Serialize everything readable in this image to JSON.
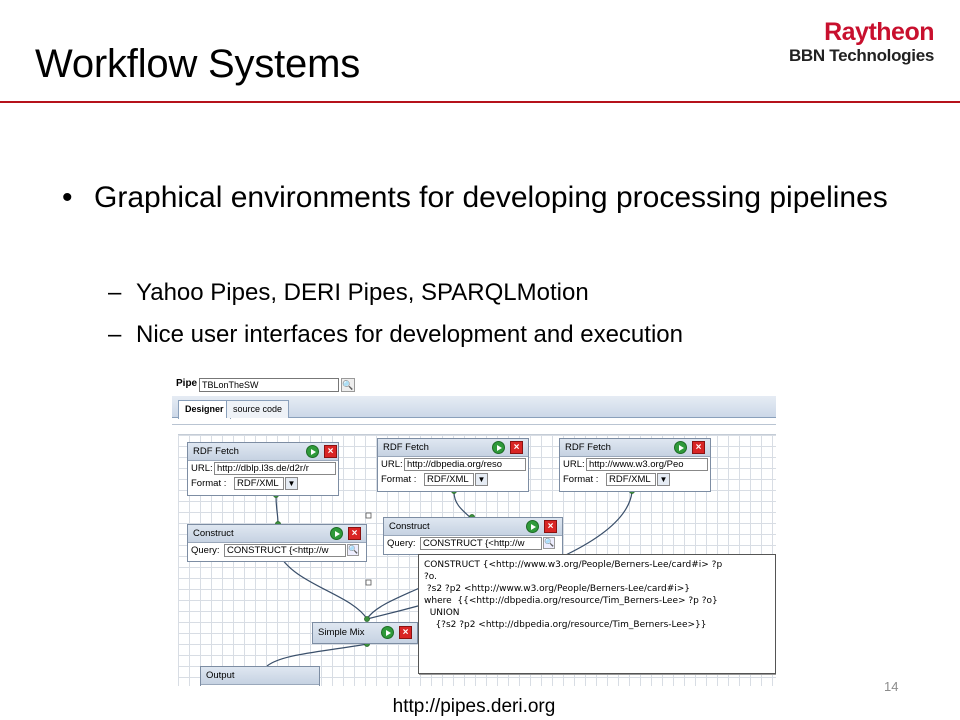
{
  "slide": {
    "title": "Workflow Systems",
    "page_number": "14",
    "caption": "http://pipes.deri.org"
  },
  "logo": {
    "brand": "Raytheon",
    "sub": "BBN Technologies"
  },
  "bullets": {
    "main": "Graphical environments for developing processing pipelines",
    "sub": [
      "Yahoo Pipes, DERI Pipes, SPARQLMotion",
      "Nice user interfaces for development and execution"
    ]
  },
  "pipes_ui": {
    "pipe_id_label": "Pipe id",
    "pipe_id_value": "TBLonTheSW",
    "tabs": [
      "Designer",
      "source code"
    ],
    "modules": {
      "fetch1": {
        "title": "RDF Fetch",
        "url_label": "URL:",
        "url": "http://dblp.l3s.de/d2r/r",
        "format_label": "Format :",
        "format": "RDF/XML"
      },
      "fetch2": {
        "title": "RDF Fetch",
        "url_label": "URL:",
        "url": "http://dbpedia.org/reso",
        "format_label": "Format :",
        "format": "RDF/XML"
      },
      "fetch3": {
        "title": "RDF Fetch",
        "url_label": "URL:",
        "url": "http://www.w3.org/Peo",
        "format_label": "Format :",
        "format": "RDF/XML"
      },
      "construct1": {
        "title": "Construct",
        "query_label": "Query:",
        "query": "CONSTRUCT {<http://w"
      },
      "construct2": {
        "title": "Construct",
        "query_label": "Query:",
        "query": "CONSTRUCT {<http://w"
      },
      "mix": {
        "title": "Simple Mix"
      },
      "output": {
        "title": "Output"
      }
    },
    "code_lines": [
      "CONSTRUCT {<http://www.w3.org/People/Berners-Lee/card#i> ?p",
      "?o.",
      " ?s2 ?p2 <http://www.w3.org/People/Berners-Lee/card#i>}",
      "where  {{<http://dbpedia.org/resource/Tim_Berners-Lee> ?p ?o}",
      "  UNION",
      "    {?s2 ?p2 <http://dbpedia.org/resource/Tim_Berners-Lee>}}"
    ],
    "colors": {
      "accent": "#b5121b",
      "run": "#2f9a3a",
      "close": "#d92525",
      "connector": "#3c8f3c"
    },
    "icons": [
      "search-icon",
      "run-icon",
      "close-icon",
      "dropdown-arrow-icon"
    ]
  }
}
